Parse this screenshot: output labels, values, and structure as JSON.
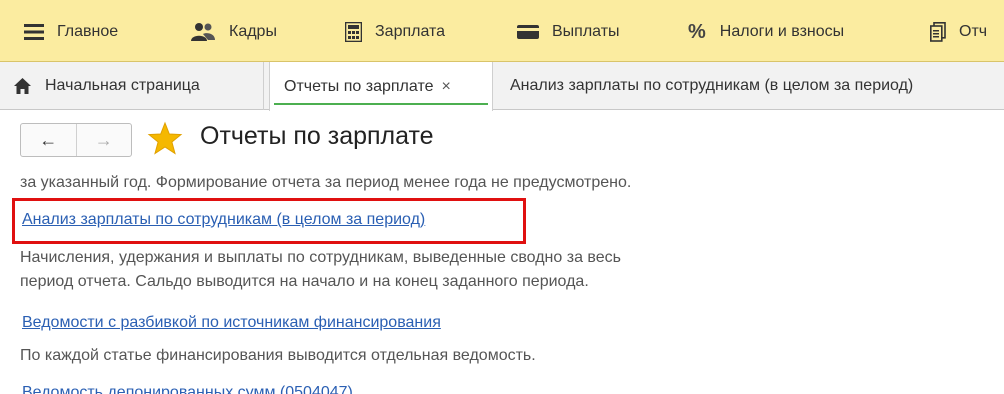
{
  "sections": {
    "main": "Главное",
    "hr": "Кадры",
    "salary": "Зарплата",
    "payments": "Выплаты",
    "taxes": "Налоги и взносы",
    "reports_partial": "Отч"
  },
  "icons": {
    "main": "menu-icon",
    "hr": "people-icon",
    "salary": "calculator-icon",
    "payments": "card-icon",
    "taxes": "percent-icon",
    "reports": "document-icon"
  },
  "tabs": {
    "home": "Начальная страница",
    "salary_reports": "Отчеты по зарплате",
    "close_symbol": "×",
    "analysis": "Анализ зарплаты по сотрудникам (в целом за период)"
  },
  "page": {
    "title": "Отчеты по зарплате",
    "back_symbol": "←",
    "forward_symbol": "→"
  },
  "content": {
    "intro_tail": "за указанный год. Формирование отчета за период менее года не предусмотрено.",
    "report1_link": "Анализ зарплаты по сотрудникам (в целом за период)",
    "report1_desc_line1": "Начисления, удержания и выплаты по сотрудникам, выведенные сводно за весь",
    "report1_desc_line2": "период отчета. Сальдо выводится на начало и на конец заданного периода.",
    "report2_link": "Ведомости с разбивкой по источникам финансирования",
    "report2_desc": "По каждой статье финансирования выводится отдельная ведомость.",
    "report3_link_partial": "Ведомость депонированных сумм (0504047)"
  },
  "colors": {
    "section_bar": "#fbeca0",
    "link": "#2a5fb3",
    "highlight": "#e01010",
    "active_tab_accent": "#4caf50"
  }
}
